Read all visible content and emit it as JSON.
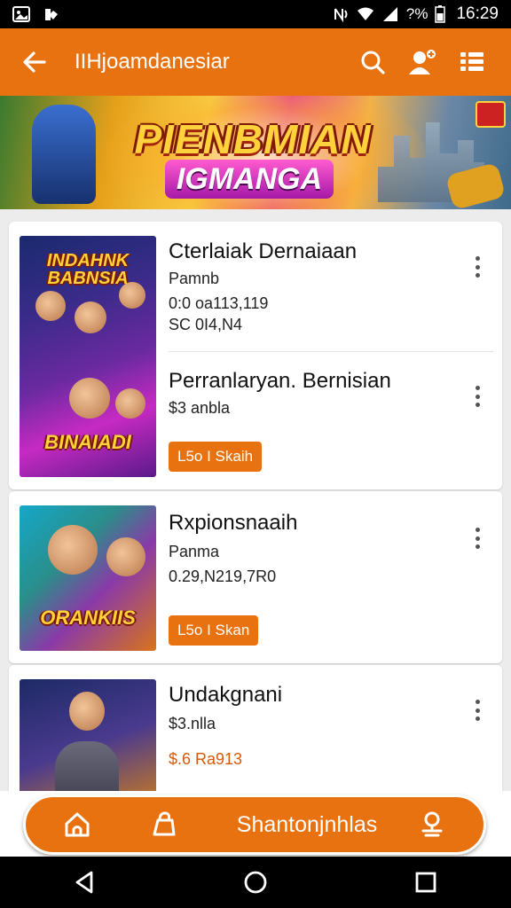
{
  "status_bar": {
    "battery_text": "?%",
    "time": "16:29"
  },
  "app_bar": {
    "title": "IIHjoamdanesiar",
    "back_icon": "arrow-left-icon",
    "search_icon": "search-icon",
    "profile_icon": "user-add-icon",
    "menu_icon": "grid-menu-icon"
  },
  "banner": {
    "title_line1": "PIENBMIAN",
    "title_line2": "IGMANGA"
  },
  "items": [
    {
      "thumb_caption_top": "INDAHNK BABNSIA",
      "thumb_caption_bottom": "BINAIADI",
      "entries": [
        {
          "title": "Cterlaiak Dernaiaan",
          "subtitle": "Pamnb",
          "line1": "0:0 oa113,119",
          "line2": "SC 0I4,N4"
        },
        {
          "title": "Perranlaryan. Bernisian",
          "subtitle": "$3 anbla"
        }
      ],
      "button_label": "L5o I Skaih"
    },
    {
      "thumb_caption_bottom": "ORANKIIS",
      "title": "Rxpionsnaaih",
      "subtitle": "Panma",
      "line1": "0.29,N219,7R0",
      "button_label": "L5o I Skan"
    },
    {
      "title": "Undakgnani",
      "subtitle": "$3.nlla",
      "price": "$.6 Ra913"
    }
  ],
  "bottom_nav": {
    "home_icon": "home-icon",
    "bag_icon": "shopping-bag-icon",
    "label": "Shantonjnhlas",
    "account_icon": "account-icon"
  },
  "system_nav": {
    "back_icon": "triangle-back-icon",
    "home_icon": "circle-home-icon",
    "recents_icon": "square-recents-icon"
  },
  "colors": {
    "accent": "#e8720f",
    "background": "#ececec",
    "card": "#ffffff"
  }
}
